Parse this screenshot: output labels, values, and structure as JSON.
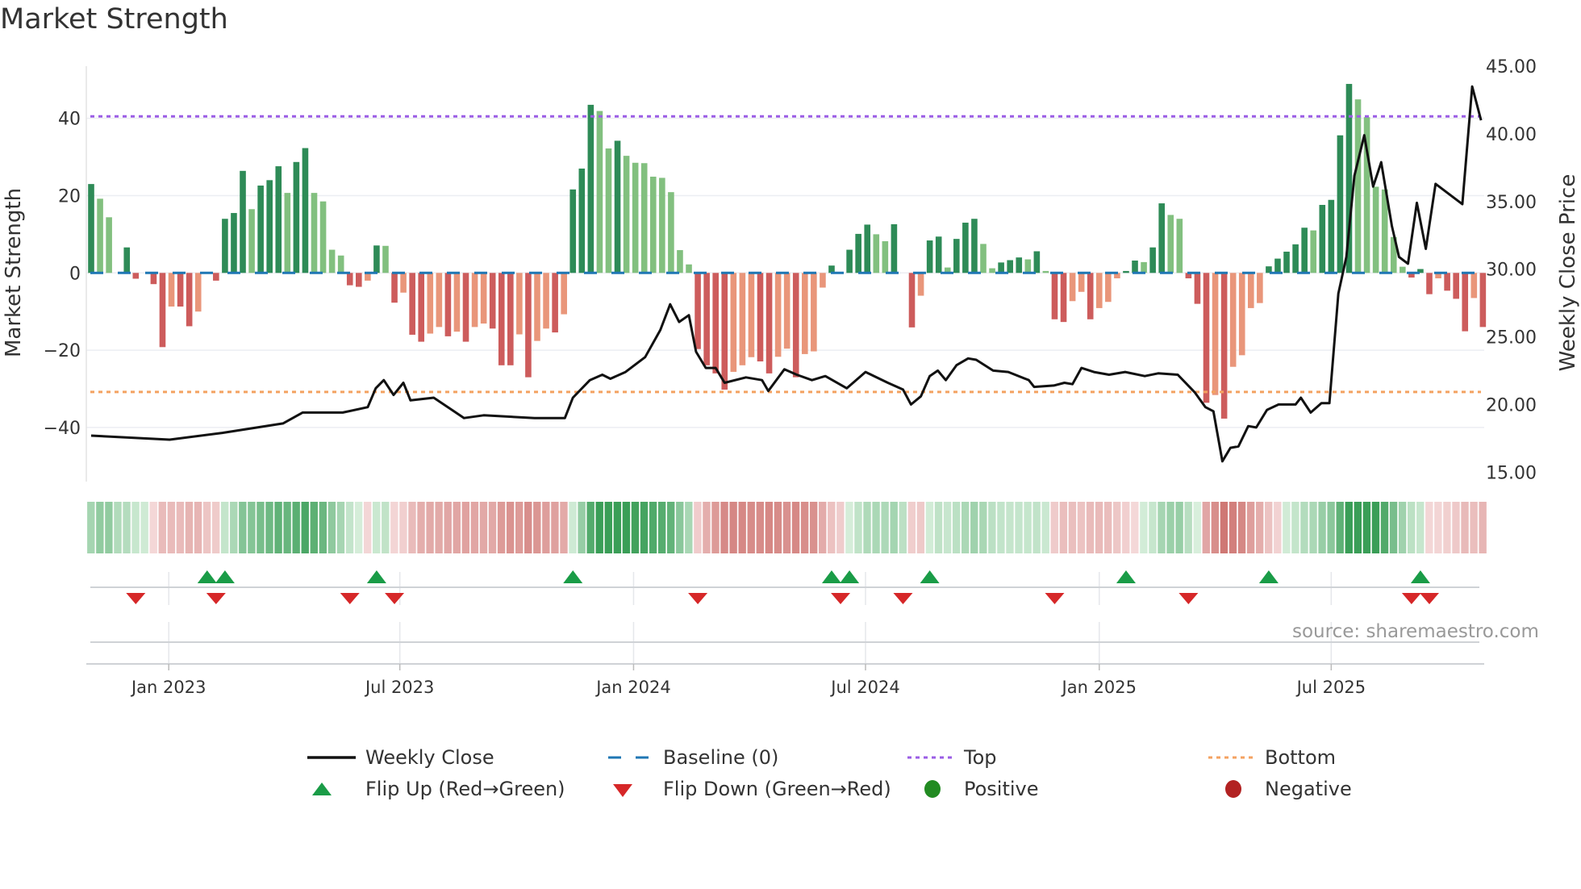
{
  "title": "Market Strength",
  "source": "source: sharemaestro.com",
  "colors": {
    "dark_green": "#2e8b57",
    "light_green": "#82c07f",
    "red": "#cd5c5c",
    "salmon": "#e9967a",
    "baseline": "#1f77b4",
    "top": "#9b5de5",
    "bottom": "#f4a261",
    "flip_up": "#1a9c47",
    "flip_down": "#d62728",
    "positive": "#228b22",
    "negative": "#b22222",
    "close": "#111111"
  },
  "chart_data": {
    "type": "bar",
    "title": "Market Strength",
    "ylabel": "Market Strength",
    "ylabel_right": "Weekly Close Price",
    "ylim": [
      -54,
      53.5
    ],
    "ylim_right": [
      14.3,
      45
    ],
    "yticks": [
      {
        "value": 40,
        "label": "40"
      },
      {
        "value": 20,
        "label": "20"
      },
      {
        "value": 0,
        "label": "0"
      },
      {
        "value": -20,
        "label": "−20"
      },
      {
        "value": -40,
        "label": "−40"
      }
    ],
    "yticks_right": [
      {
        "value": 45,
        "label": "45.00"
      },
      {
        "value": 40,
        "label": "40.00"
      },
      {
        "value": 35,
        "label": "35.00"
      },
      {
        "value": 30,
        "label": "30.00"
      },
      {
        "value": 25,
        "label": "25.00"
      },
      {
        "value": 20,
        "label": "20.00"
      },
      {
        "value": 15,
        "label": "15.00"
      }
    ],
    "xticks": [
      {
        "week": 8.7,
        "label": "Jan 2023"
      },
      {
        "week": 34.6,
        "label": "Jul 2023"
      },
      {
        "week": 60.8,
        "label": "Jan 2024"
      },
      {
        "week": 86.8,
        "label": "Jul 2024"
      },
      {
        "week": 113,
        "label": "Jan 2025"
      },
      {
        "week": 139,
        "label": "Jul 2025"
      }
    ],
    "top_level": 40.5,
    "bottom_level": -30.8,
    "baseline": 0,
    "strength": [
      23,
      19.2,
      14.4,
      0,
      6.6,
      -1.5,
      0,
      -2.9,
      -19.2,
      -8.7,
      -8.7,
      -13.8,
      -10,
      0,
      -2,
      14,
      15.5,
      26.4,
      16.5,
      22.6,
      24,
      27.6,
      20.7,
      28.7,
      32.3,
      20.7,
      18.5,
      6,
      4.5,
      -3.2,
      -3.6,
      -2,
      7.1,
      7,
      -7.7,
      -5.1,
      -16,
      -17.8,
      -15.7,
      -14,
      -16.4,
      -15.2,
      -17.8,
      -14,
      -13.1,
      -14.4,
      -23.9,
      -23.9,
      -15.9,
      -27,
      -17.6,
      -14.4,
      -15.4,
      -10.7,
      21.6,
      27,
      43.5,
      41.9,
      32.2,
      34.2,
      30.3,
      28.5,
      28.4,
      24.9,
      24.6,
      20.9,
      5.9,
      2.2,
      -19.7,
      -23.9,
      -26,
      -30.2,
      -25.6,
      -23.9,
      -21.8,
      -22.9,
      -26,
      -21.7,
      -19.6,
      -27,
      -21,
      -20.3,
      -3.8,
      1.9,
      0,
      6,
      10.1,
      12.5,
      10,
      8.2,
      12.6,
      0,
      -14.1,
      -5.9,
      8.4,
      9.4,
      1.4,
      8.8,
      13,
      14,
      7.5,
      1.2,
      2.7,
      3.3,
      4,
      3.5,
      5.6,
      0.5,
      -12,
      -12.7,
      -7.3,
      -4.9,
      -12,
      -9.1,
      -7.5,
      -1.4,
      0.5,
      3.2,
      2.8,
      6.6,
      18,
      15,
      14,
      -1.4,
      -8,
      -33.6,
      -31.6,
      -37.7,
      -24.3,
      -21.3,
      -9.1,
      -7.8,
      1.7,
      3.7,
      5.5,
      7.4,
      11.7,
      11,
      17.6,
      18.9,
      35.6,
      48.9,
      44.9,
      40.3,
      22.3,
      21.6,
      9.3,
      1.6,
      -1.2,
      1,
      -5.5,
      -1.4,
      -4.6,
      -6.7,
      -15.1,
      -6.5,
      -14
    ],
    "weekly_close": [
      [
        0,
        17.7
      ],
      [
        8.8,
        17.4
      ],
      [
        14.7,
        17.9
      ],
      [
        21.5,
        18.6
      ],
      [
        23.7,
        19.4
      ],
      [
        28.2,
        19.4
      ],
      [
        31,
        19.8
      ],
      [
        31.9,
        21.2
      ],
      [
        32.8,
        21.8
      ],
      [
        33.9,
        20.7
      ],
      [
        35,
        21.6
      ],
      [
        35.8,
        20.3
      ],
      [
        38.4,
        20.5
      ],
      [
        41.8,
        19
      ],
      [
        44,
        19.2
      ],
      [
        49.7,
        19
      ],
      [
        53.1,
        19
      ],
      [
        54,
        20.5
      ],
      [
        55.9,
        21.8
      ],
      [
        57.3,
        22.2
      ],
      [
        58.2,
        21.9
      ],
      [
        59.9,
        22.4
      ],
      [
        62.1,
        23.5
      ],
      [
        63.8,
        25.5
      ],
      [
        64.9,
        27.4
      ],
      [
        65.9,
        26.1
      ],
      [
        67,
        26.6
      ],
      [
        67.8,
        23.9
      ],
      [
        68.9,
        22.7
      ],
      [
        70,
        22.7
      ],
      [
        71,
        21.6
      ],
      [
        73.4,
        22
      ],
      [
        75.2,
        21.8
      ],
      [
        75.9,
        21
      ],
      [
        77.7,
        22.6
      ],
      [
        79.1,
        22.2
      ],
      [
        80.8,
        21.8
      ],
      [
        82.3,
        22.1
      ],
      [
        84.7,
        21.2
      ],
      [
        86.8,
        22.4
      ],
      [
        89.3,
        21.6
      ],
      [
        91,
        21.1
      ],
      [
        91.9,
        20
      ],
      [
        93,
        20.6
      ],
      [
        94,
        22.1
      ],
      [
        94.9,
        22.5
      ],
      [
        95.8,
        21.8
      ],
      [
        97,
        22.9
      ],
      [
        98.3,
        23.4
      ],
      [
        99.2,
        23.3
      ],
      [
        101.1,
        22.5
      ],
      [
        102.8,
        22.4
      ],
      [
        105.1,
        21.8
      ],
      [
        105.7,
        21.3
      ],
      [
        107.9,
        21.4
      ],
      [
        109.1,
        21.6
      ],
      [
        110,
        21.5
      ],
      [
        111,
        22.7
      ],
      [
        112.4,
        22.4
      ],
      [
        114.1,
        22.2
      ],
      [
        115.9,
        22.4
      ],
      [
        118.1,
        22.1
      ],
      [
        119.6,
        22.3
      ],
      [
        121.8,
        22.2
      ],
      [
        123.7,
        20.9
      ],
      [
        124.9,
        19.8
      ],
      [
        125.8,
        19.5
      ],
      [
        126.8,
        15.8
      ],
      [
        127.7,
        16.8
      ],
      [
        128.6,
        16.9
      ],
      [
        129.7,
        18.4
      ],
      [
        130.6,
        18.3
      ],
      [
        131.8,
        19.6
      ],
      [
        133.1,
        20
      ],
      [
        135,
        20
      ],
      [
        135.6,
        20.5
      ],
      [
        136.7,
        19.4
      ],
      [
        137.9,
        20.1
      ],
      [
        138.8,
        20.1
      ],
      [
        139.8,
        28.2
      ],
      [
        140.7,
        30.9
      ],
      [
        141.6,
        36.9
      ],
      [
        142.7,
        39.9
      ],
      [
        143.7,
        36.1
      ],
      [
        144.6,
        37.9
      ],
      [
        145.8,
        33.2
      ],
      [
        146.6,
        30.9
      ],
      [
        147.6,
        30.4
      ],
      [
        148.6,
        34.9
      ],
      [
        149.6,
        31.5
      ],
      [
        150.7,
        36.3
      ],
      [
        153.7,
        34.8
      ],
      [
        154.8,
        43.5
      ],
      [
        155.8,
        41
      ]
    ],
    "flip_up_weeks": [
      13,
      15,
      32,
      54,
      83,
      85,
      94,
      116,
      132,
      149
    ],
    "flip_down_weeks": [
      5,
      14,
      29,
      34,
      68,
      84,
      91,
      108,
      123,
      148,
      150
    ]
  },
  "legend": [
    {
      "label": "Weekly Close"
    },
    {
      "label": "Baseline (0)"
    },
    {
      "label": "Top"
    },
    {
      "label": "Bottom"
    },
    {
      "label": "Flip Up (Red→Green)"
    },
    {
      "label": "Flip Down (Green→Red)"
    },
    {
      "label": "Positive"
    },
    {
      "label": "Negative"
    }
  ]
}
